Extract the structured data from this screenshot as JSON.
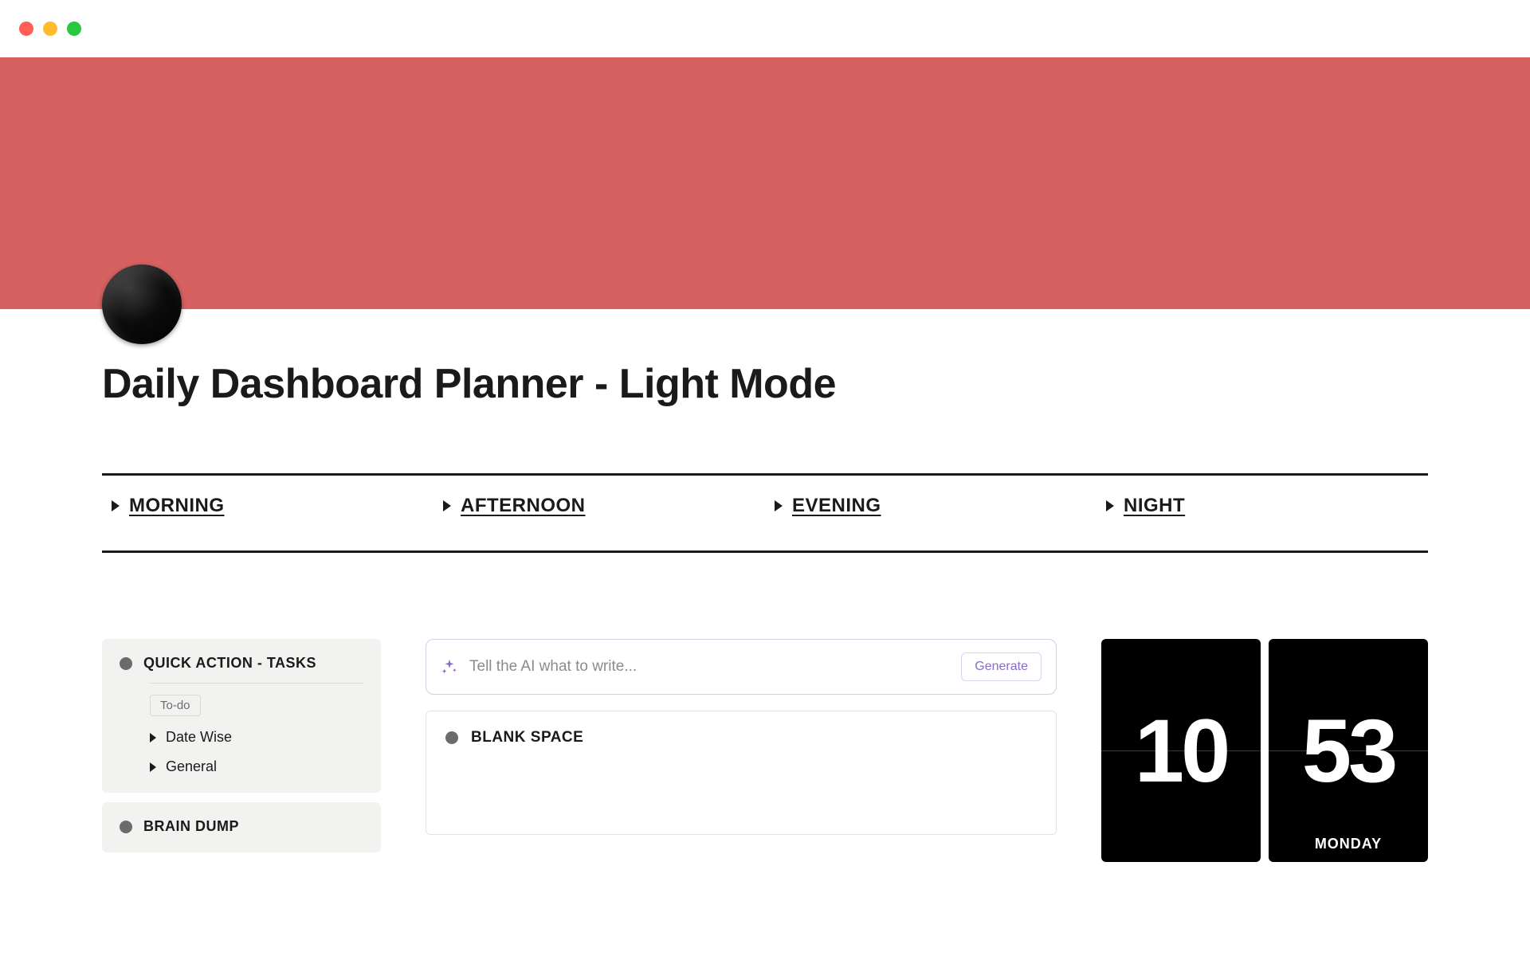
{
  "page": {
    "title": "Daily Dashboard Planner - Light Mode"
  },
  "sections": [
    {
      "label": "MORNING"
    },
    {
      "label": "AFTERNOON"
    },
    {
      "label": "EVENING"
    },
    {
      "label": "NIGHT"
    }
  ],
  "sidebar": {
    "blocks": [
      {
        "title": "QUICK ACTION - TASKS",
        "tab": "To-do",
        "items": [
          {
            "label": "Date Wise"
          },
          {
            "label": "General"
          }
        ]
      },
      {
        "title": "BRAIN DUMP"
      }
    ]
  },
  "ai": {
    "placeholder": "Tell the AI what to write...",
    "button": "Generate"
  },
  "blank": {
    "title": "BLANK SPACE"
  },
  "clock": {
    "hours": "10",
    "minutes": "53",
    "day": "MONDAY"
  },
  "colors": {
    "cover": "#d56161",
    "accent": "#8a6cc9"
  }
}
